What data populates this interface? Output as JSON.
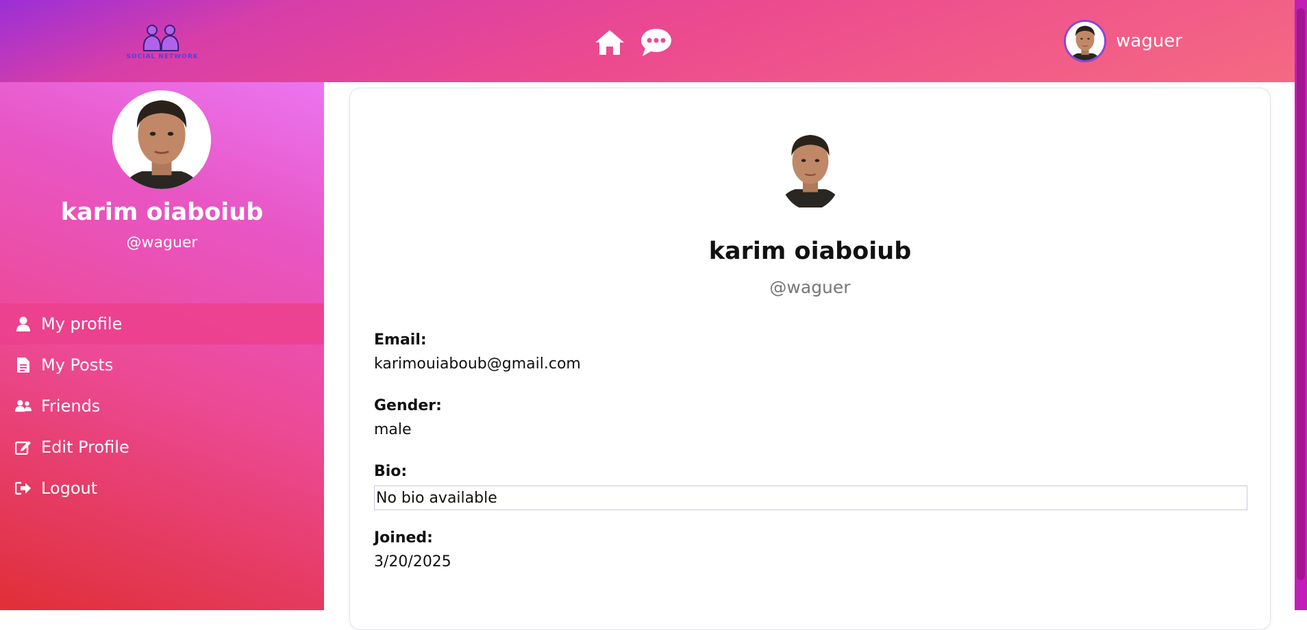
{
  "header": {
    "logo_text": "SOCIAL NETWORK",
    "nav_icons": [
      "home-icon",
      "chat-icon"
    ],
    "username": "waguer"
  },
  "sidebar": {
    "full_name": "karim oiaboiub",
    "handle": "@waguer",
    "menu": [
      {
        "label": "My profile",
        "icon": "user-icon",
        "active": true
      },
      {
        "label": "My Posts",
        "icon": "document-icon",
        "active": false
      },
      {
        "label": "Friends",
        "icon": "users-icon",
        "active": false
      },
      {
        "label": "Edit Profile",
        "icon": "edit-icon",
        "active": false
      },
      {
        "label": "Logout",
        "icon": "logout-icon",
        "active": false
      }
    ]
  },
  "profile": {
    "full_name": "karim oiaboiub",
    "handle": "@waguer",
    "fields": {
      "email_label": "Email:",
      "email": "karimouiaboub@gmail.com",
      "gender_label": "Gender:",
      "gender": "male",
      "bio_label": "Bio:",
      "bio": "No bio available",
      "joined_label": "Joined:",
      "joined": "3/20/2025"
    }
  },
  "colors": {
    "accent_pink": "#ec4a8f",
    "accent_purple": "#9b2fd6",
    "sidebar_red": "#e02f37"
  }
}
